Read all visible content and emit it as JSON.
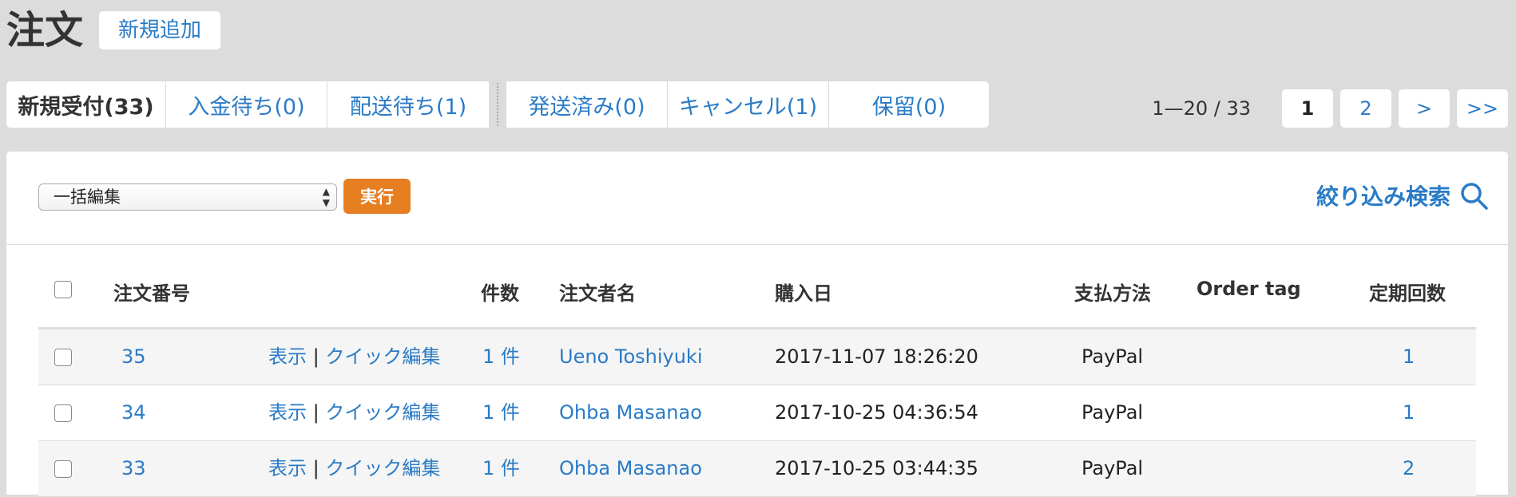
{
  "header": {
    "title": "注文",
    "add_new_label": "新規追加"
  },
  "tabs": [
    {
      "label": "新規受付(33)"
    },
    {
      "label": "入金待ち(0)"
    },
    {
      "label": "配送待ち(1)"
    },
    {
      "label": "発送済み(0)"
    },
    {
      "label": "キャンセル(1)"
    },
    {
      "label": "保留(0)"
    }
  ],
  "pagination": {
    "info": "1—20 / 33",
    "pages": [
      "1",
      "2",
      ">",
      ">>"
    ],
    "current": "1"
  },
  "toolbar": {
    "bulk_select_value": "一括編集",
    "run_label": "実行",
    "filter_label": "絞り込み検索"
  },
  "table": {
    "columns": [
      "注文番号",
      "件数",
      "注文者名",
      "購入日",
      "支払方法",
      "Order tag",
      "定期回数"
    ],
    "view_label": "表示",
    "action_separator": "|",
    "quick_edit_label": "クイック編集",
    "rows": [
      {
        "order_no": "35",
        "count": "1 件",
        "customer": "Ueno Toshiyuki",
        "date": "2017-11-07 18:26:20",
        "payment": "PayPal",
        "tag": "",
        "recurring": "1"
      },
      {
        "order_no": "34",
        "count": "1 件",
        "customer": "Ohba Masanao",
        "date": "2017-10-25 04:36:54",
        "payment": "PayPal",
        "tag": "",
        "recurring": "1"
      },
      {
        "order_no": "33",
        "count": "1 件",
        "customer": "Ohba Masanao",
        "date": "2017-10-25 03:44:35",
        "payment": "PayPal",
        "tag": "",
        "recurring": "2"
      }
    ]
  },
  "colors": {
    "link": "#2a7bc7",
    "accent": "#e67e22",
    "background": "#dcdcdc"
  }
}
